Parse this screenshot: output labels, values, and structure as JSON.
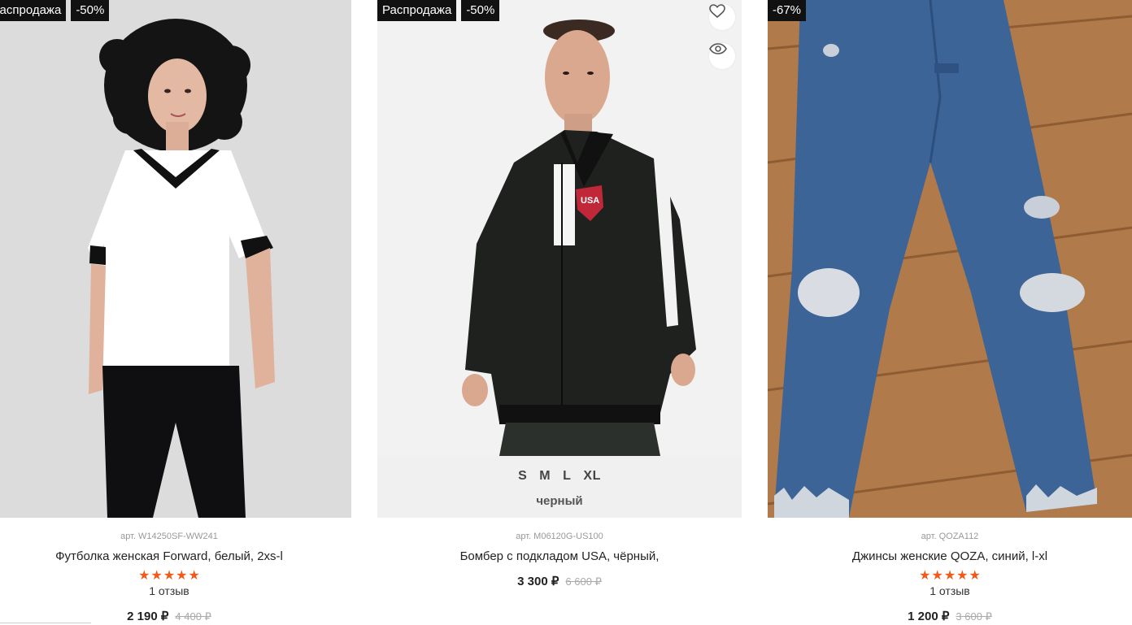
{
  "products": [
    {
      "badges": [
        "Распродажа",
        "-50%"
      ],
      "article": "арт. W14250SF-WW241",
      "name": "Футболка женская Forward, белый, 2xs-l",
      "rating": 5,
      "reviews": "1 отзыв",
      "price": "2 190 ₽",
      "old_price": "4 400 ₽",
      "image": "woman in white t-shirt with black v-neck trim and black pants"
    },
    {
      "badges": [
        "Распродажа",
        "-50%"
      ],
      "article": "арт. M06120G-US100",
      "name": "Бомбер с подкладом USA, чёрный,",
      "sizes": [
        "S",
        "M",
        "L",
        "XL"
      ],
      "color": "черный",
      "price": "3 300 ₽",
      "old_price": "6 600 ₽",
      "image": "man in black bomber jacket with USA crest"
    },
    {
      "badges": [
        "-67%"
      ],
      "article": "арт. QOZA112",
      "name": "Джинсы женские QOZA, синий, l-xl",
      "rating": 5,
      "reviews": "1 отзыв",
      "price": "1 200 ₽",
      "old_price": "3 600 ₽",
      "image": "ripped blue jeans on wooden floor"
    }
  ],
  "icons": {
    "favorite": "heart-icon",
    "quick_view": "eye-icon",
    "rating": "star-icon"
  },
  "colors": {
    "badge_bg": "#111111",
    "star": "#f05a1a",
    "old_price": "#aaaaaa"
  }
}
